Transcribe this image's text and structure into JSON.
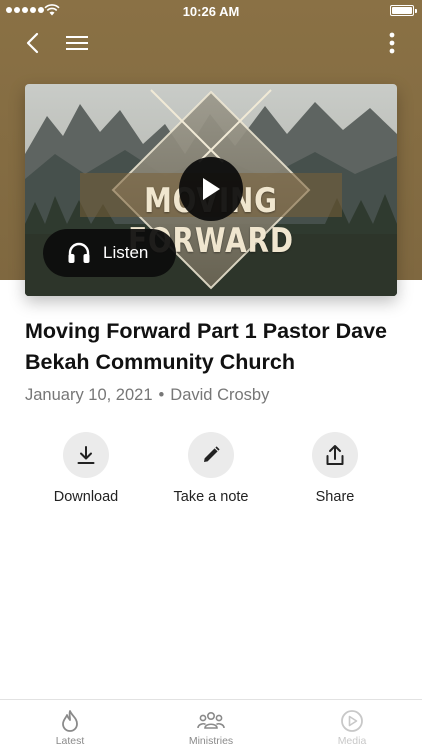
{
  "status_bar": {
    "time": "10:26 AM"
  },
  "media": {
    "artwork_title": "MOVING FORWARD",
    "listen_label": "Listen"
  },
  "content": {
    "title": "Moving Forward Part 1 Pastor Dave Bekah Community Church",
    "date": "January 10, 2021",
    "separator": "•",
    "author": "David Crosby"
  },
  "actions": [
    {
      "label": "Download",
      "icon": "download-icon"
    },
    {
      "label": "Take a note",
      "icon": "pencil-icon"
    },
    {
      "label": "Share",
      "icon": "share-icon"
    }
  ],
  "tabs": [
    {
      "label": "Latest",
      "icon": "flame-icon"
    },
    {
      "label": "Ministries",
      "icon": "group-icon"
    },
    {
      "label": "Media",
      "icon": "play-circle-icon"
    }
  ],
  "colors": {
    "header": "#8a7145",
    "button_bg": "#ebebeb",
    "tab_inactive": "#8a8a8a"
  }
}
